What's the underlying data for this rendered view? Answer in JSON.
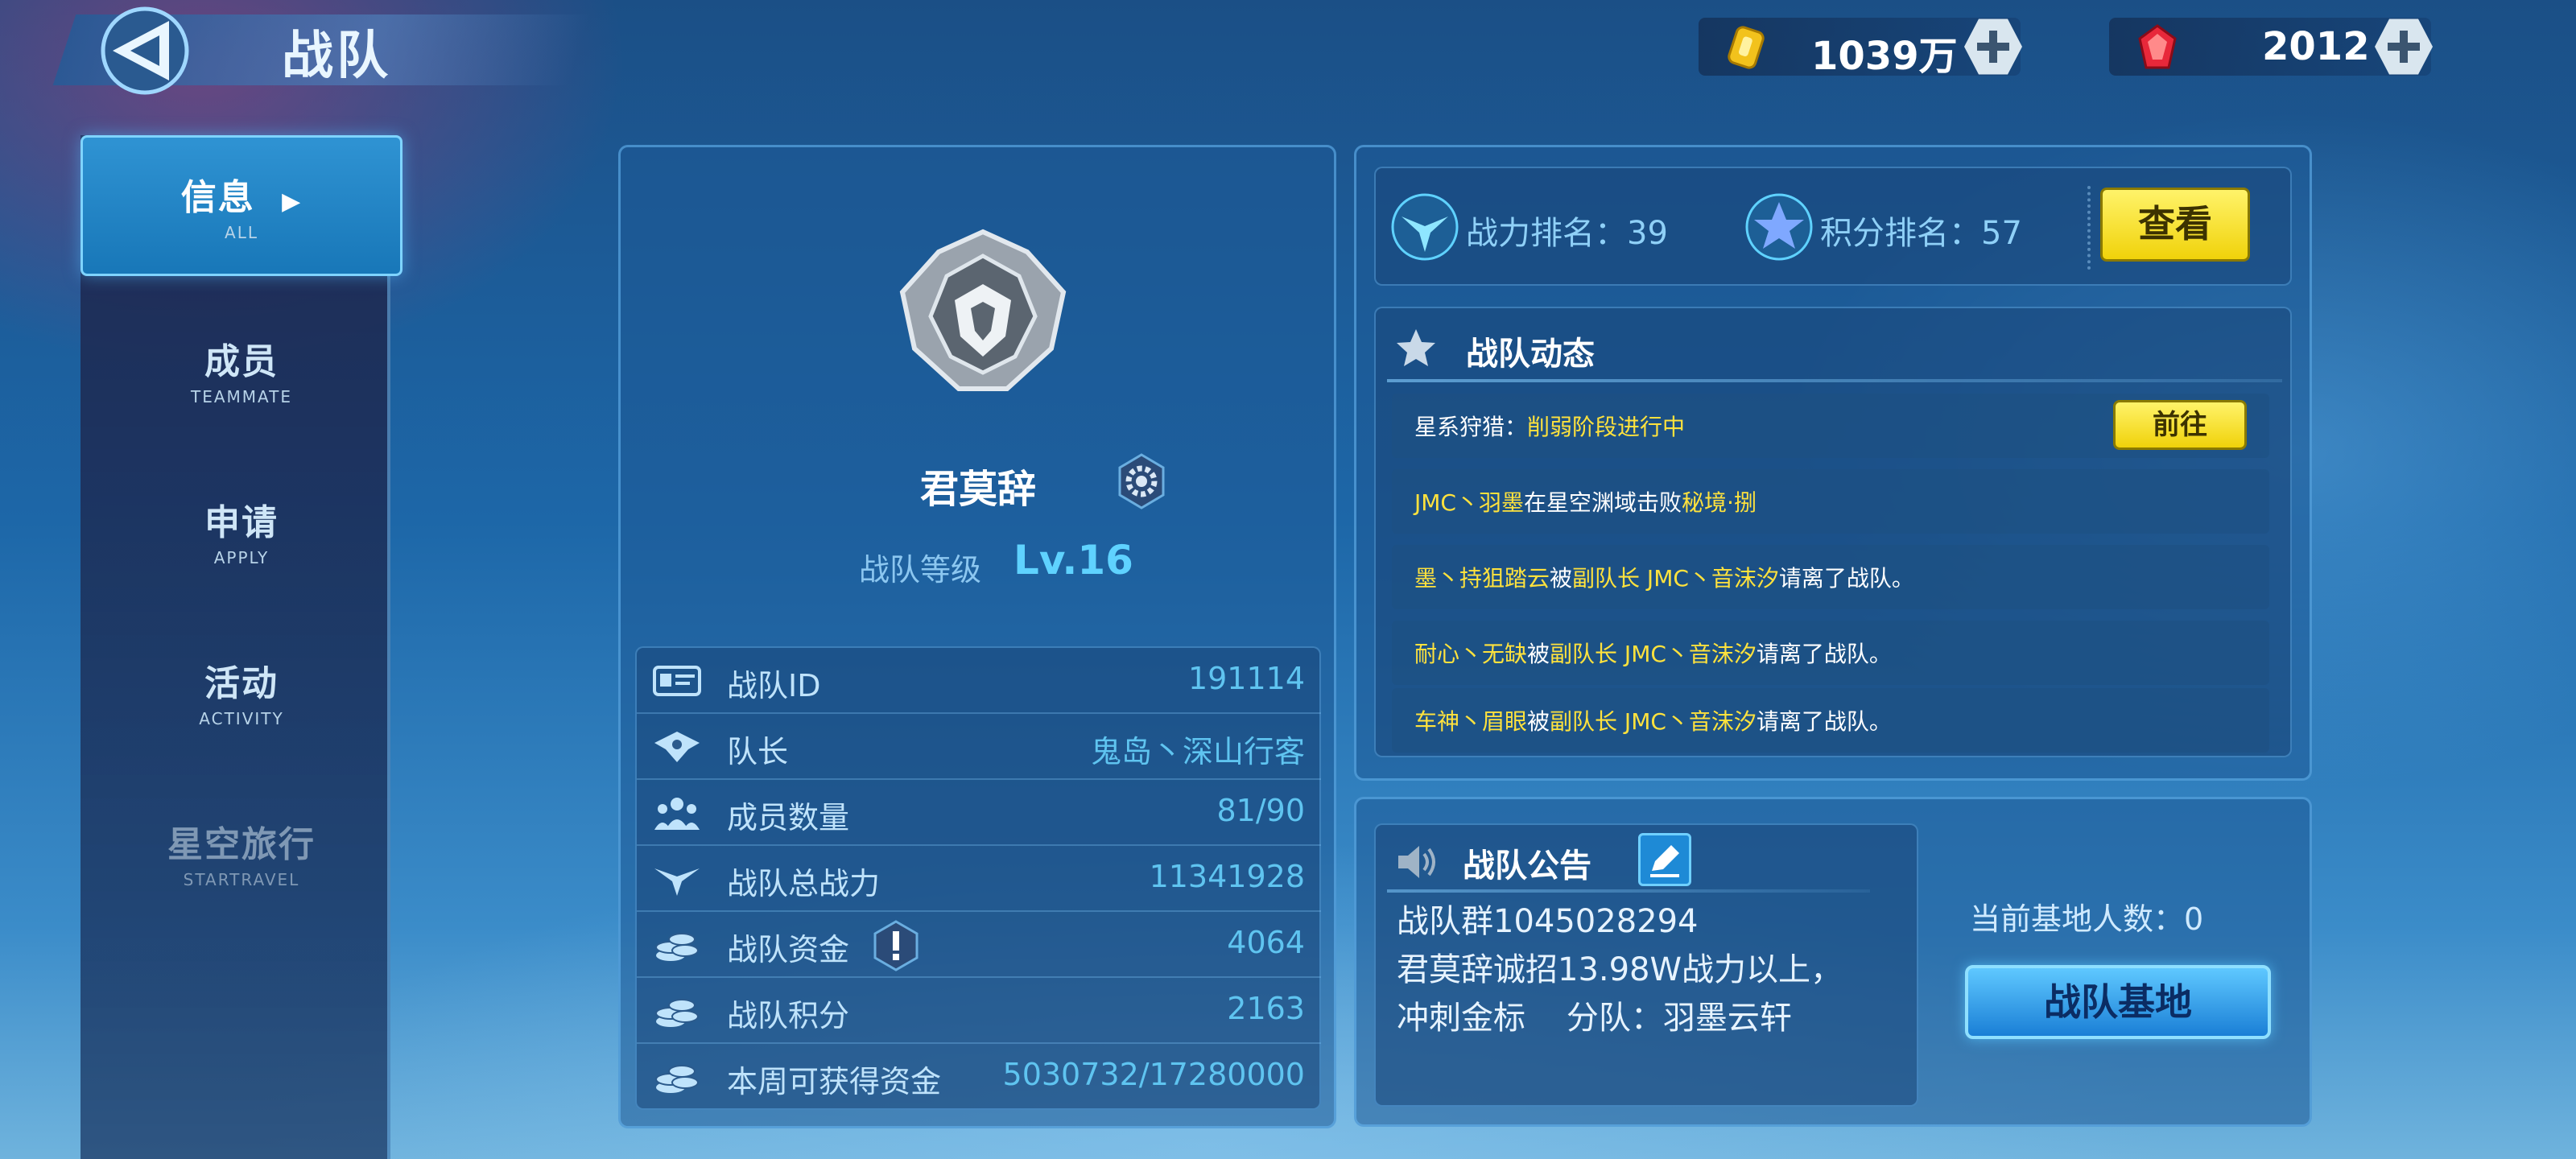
{
  "header": {
    "title": "战队",
    "gold": {
      "value": "1039万",
      "icon": "gold-ticket-icon"
    },
    "gems": {
      "value": "2012",
      "icon": "red-gem-icon"
    }
  },
  "sidebar": {
    "items": [
      {
        "cn": "信息",
        "en": "ALL",
        "active": true
      },
      {
        "cn": "成员",
        "en": "TEAMMATE"
      },
      {
        "cn": "申请",
        "en": "APPLY"
      },
      {
        "cn": "活动",
        "en": "ACTIVITY"
      },
      {
        "cn": "星空旅行",
        "en": "STARTRAVEL",
        "disabled": true
      }
    ]
  },
  "team": {
    "name": "君莫辞",
    "level_label": "战队等级",
    "level": "Lv.16",
    "stats": [
      {
        "label": "战队ID",
        "value": "191114",
        "icon": "id-card-icon"
      },
      {
        "label": "队长",
        "value": "鬼岛丶深山行客",
        "icon": "captain-icon"
      },
      {
        "label": "成员数量",
        "value": "81/90",
        "icon": "members-icon"
      },
      {
        "label": "战队总战力",
        "value": "11341928",
        "icon": "power-icon"
      },
      {
        "label": "战队资金",
        "value": "4064",
        "icon": "coins-icon"
      },
      {
        "label": "战队积分",
        "value": "2163",
        "icon": "coins-icon"
      },
      {
        "label": "本周可获得资金",
        "value": "5030732/17280000",
        "icon": "coins-icon"
      }
    ]
  },
  "ranking": {
    "power_label": "战力排名：39",
    "score_label": "积分排名：57",
    "view_button": "查看"
  },
  "news": {
    "title": "战队动态",
    "hunt_label": "星系狩猎：",
    "hunt_status": "削弱阶段进行中",
    "goto_button": "前往",
    "events": [
      [
        {
          "t": "JMC丶羽墨",
          "h": true
        },
        {
          "t": "在星空渊域击败"
        },
        {
          "t": "秘境·捌",
          "h": true
        }
      ],
      [
        {
          "t": "墨丶持狙踏云",
          "h": true
        },
        {
          "t": "被"
        },
        {
          "t": "副队长 JMC丶音沫汐",
          "h": true
        },
        {
          "t": "请离了战队。"
        }
      ],
      [
        {
          "t": "耐心丶无缺",
          "h": true
        },
        {
          "t": "被"
        },
        {
          "t": "副队长 JMC丶音沫汐",
          "h": true
        },
        {
          "t": "请离了战队。"
        }
      ],
      [
        {
          "t": "车神丶眉眼",
          "h": true
        },
        {
          "t": "被"
        },
        {
          "t": "副队长 JMC丶音沫汐",
          "h": true
        },
        {
          "t": "请离了战队。"
        }
      ]
    ]
  },
  "notice": {
    "title": "战队公告",
    "lines": [
      "战队群1045028294",
      "君莫辞诚招13.98W战力以上，",
      "冲刺金标    分队：羽墨云轩"
    ]
  },
  "base": {
    "count_label": "当前基地人数：0",
    "button": "战队基地"
  }
}
